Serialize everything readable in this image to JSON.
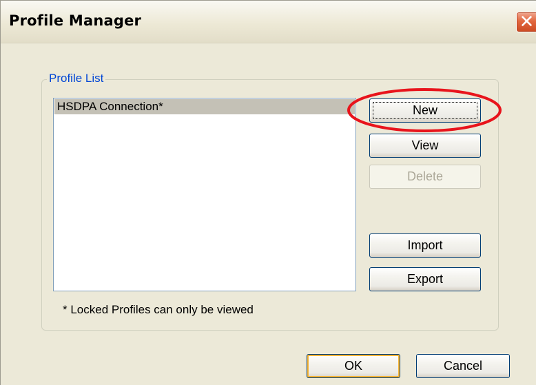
{
  "window": {
    "title": "Profile Manager",
    "close_glyph": "✕"
  },
  "group": {
    "legend": "Profile List"
  },
  "profiles": [
    {
      "label": "HSDPA Connection*",
      "selected": true
    }
  ],
  "buttons": {
    "new": "New",
    "view": "View",
    "delete": "Delete",
    "import": "Import",
    "export": "Export",
    "ok": "OK",
    "cancel": "Cancel"
  },
  "note": "* Locked Profiles can only be viewed",
  "colors": {
    "window_bg": "#ece9d8",
    "legend_text": "#0046d5",
    "selection_bg": "#c4c1b6",
    "button_border": "#003c74",
    "close_button": "#e2683f",
    "annotation_ring": "#e8141c"
  },
  "icons": {
    "close": "close-icon"
  }
}
